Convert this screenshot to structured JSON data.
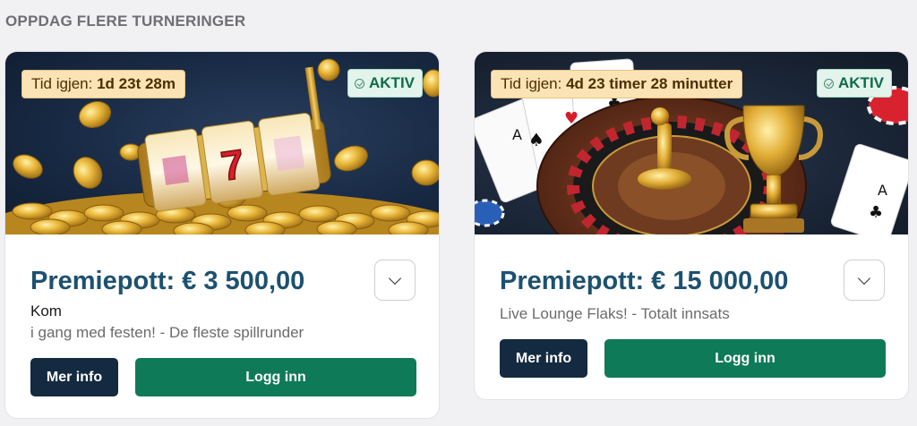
{
  "section_title": "OPPDAG FLERE TURNERINGER",
  "tournaments": [
    {
      "timer_label": "Tid igjen:",
      "timer_value": "1d 23t 28m",
      "status": "AKTIV",
      "prize": "Premiepott: € 3 500,00",
      "description_line1": "Kom",
      "description_line2": "i gang med festen! - De fleste spillrunder",
      "info_button": "Mer info",
      "login_button": "Logg inn",
      "banner_theme": "slot-machine-gold-coins"
    },
    {
      "timer_label": "Tid igjen:",
      "timer_value": "4d 23 timer 28 minutter",
      "status": "AKTIV",
      "prize": "Premiepott: € 15 000,00",
      "description_line1": "",
      "description_line2": "Live Lounge Flaks! - Totalt innsats",
      "info_button": "Mer info",
      "login_button": "Logg inn",
      "banner_theme": "roulette-cards-trophy"
    }
  ],
  "icons": {
    "status": "check-circle-icon",
    "expand": "chevron-down-icon"
  },
  "colors": {
    "prize_text": "#1d5170",
    "info_button": "#132a40",
    "login_button": "#0f7a57",
    "timer_badge": "#fbe3b6",
    "status_badge": "#e2f4ec"
  }
}
